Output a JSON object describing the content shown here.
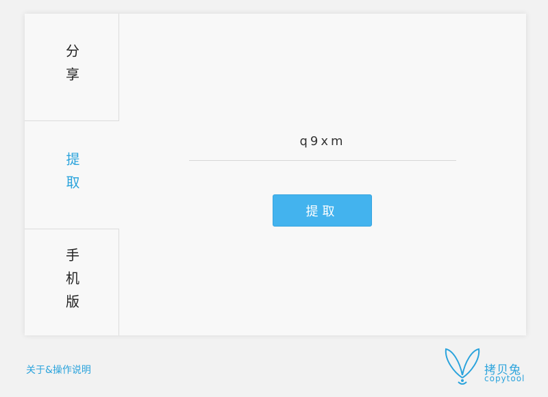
{
  "tabs": [
    {
      "label": "分享",
      "active": false
    },
    {
      "label": "提取",
      "active": true
    },
    {
      "label": "手机版",
      "active": false
    }
  ],
  "extract": {
    "code_value": "q9xm",
    "button_label": "提取"
  },
  "footer": {
    "help_link": "关于&操作说明"
  },
  "logo": {
    "name_cn": "拷贝兔",
    "name_en": "copytool"
  },
  "colors": {
    "accent": "#2aa3dc",
    "button": "#43b3ee",
    "panel": "#f8f8f8",
    "background": "#f2f2f2"
  }
}
